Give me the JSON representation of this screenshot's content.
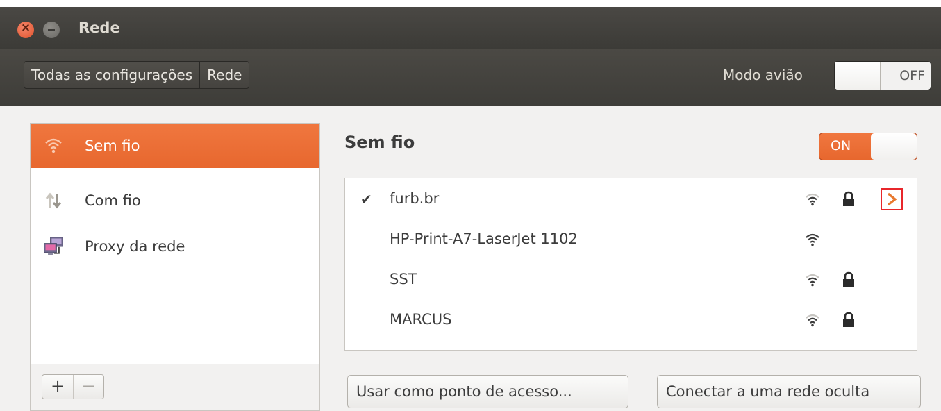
{
  "window": {
    "title": "Rede"
  },
  "header": {
    "breadcrumbs": [
      "Todas as configurações",
      "Rede"
    ],
    "airplane_label": "Modo avião",
    "airplane_state": "OFF"
  },
  "sidebar": {
    "items": [
      {
        "label": "Sem fio",
        "icon": "wifi-icon",
        "active": true
      },
      {
        "label": "Com fio",
        "icon": "wired-icon",
        "active": false
      },
      {
        "label": "Proxy da rede",
        "icon": "proxy-icon",
        "active": false
      }
    ],
    "add_label": "+",
    "remove_label": "−"
  },
  "panel": {
    "title": "Sem fio",
    "switch_state": "ON",
    "networks": [
      {
        "name": "furb.br",
        "connected": true,
        "check": "✔",
        "secured": true
      },
      {
        "name": "HP-Print-A7-LaserJet 1102",
        "connected": false,
        "check": "",
        "secured": false
      },
      {
        "name": "SST",
        "connected": false,
        "check": "",
        "secured": true
      },
      {
        "name": "MARCUS",
        "connected": false,
        "check": "",
        "secured": true
      }
    ],
    "hotspot_button": "Usar como ponto de acesso...",
    "hidden_button": "Conectar a uma rede oculta"
  },
  "colors": {
    "accent": "#e9692f",
    "titlebar": "#3c3b37",
    "highlight": "#e8262b"
  }
}
